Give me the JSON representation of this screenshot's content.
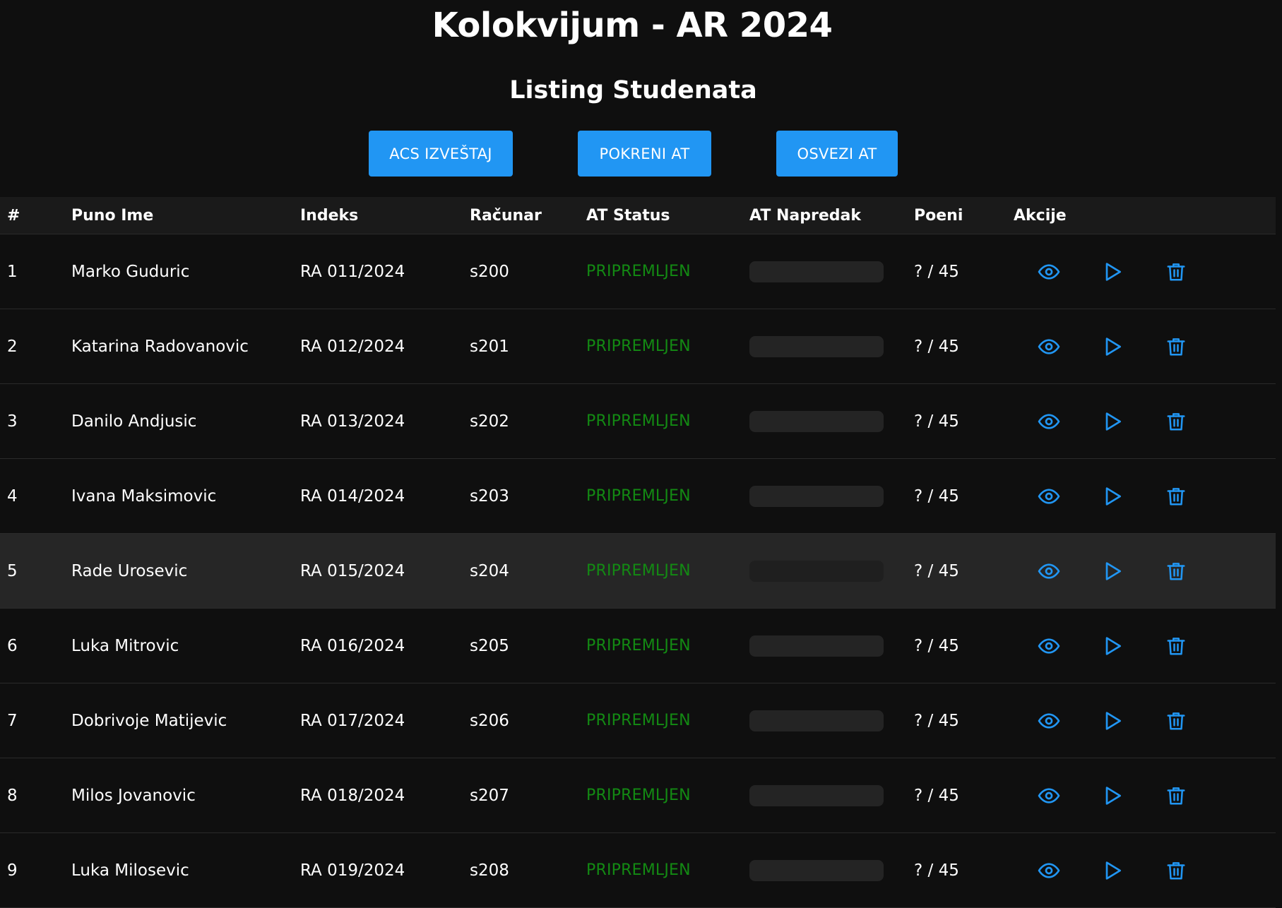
{
  "header": {
    "title": "Kolokvijum - AR 2024",
    "subtitle": "Listing Studenata"
  },
  "toolbar": {
    "acs_label": "ACS IZVEŠTAJ",
    "run_label": "POKRENI AT",
    "refresh_label": "OSVEZI AT"
  },
  "colors": {
    "accent": "#2196f3",
    "status_ok": "#138a13",
    "background": "#0f0f0f"
  },
  "table": {
    "columns": [
      "#",
      "Puno Ime",
      "Indeks",
      "Računar",
      "AT Status",
      "AT Napredak",
      "Poeni",
      "Akcije"
    ],
    "action_icons": [
      "eye-icon",
      "play-icon",
      "trash-icon"
    ],
    "rows": [
      {
        "num": "1",
        "name": "Marko Guduric",
        "index": "RA 011/2024",
        "computer": "s200",
        "status": "PRIPREMLJEN",
        "progress": 0,
        "points": "? / 45"
      },
      {
        "num": "2",
        "name": "Katarina Radovanovic",
        "index": "RA 012/2024",
        "computer": "s201",
        "status": "PRIPREMLJEN",
        "progress": 0,
        "points": "? / 45"
      },
      {
        "num": "3",
        "name": "Danilo Andjusic",
        "index": "RA 013/2024",
        "computer": "s202",
        "status": "PRIPREMLJEN",
        "progress": 0,
        "points": "? / 45"
      },
      {
        "num": "4",
        "name": "Ivana Maksimovic",
        "index": "RA 014/2024",
        "computer": "s203",
        "status": "PRIPREMLJEN",
        "progress": 0,
        "points": "? / 45"
      },
      {
        "num": "5",
        "name": "Rade Urosevic",
        "index": "RA 015/2024",
        "computer": "s204",
        "status": "PRIPREMLJEN",
        "progress": 0,
        "points": "? / 45",
        "highlighted": true
      },
      {
        "num": "6",
        "name": "Luka Mitrovic",
        "index": "RA 016/2024",
        "computer": "s205",
        "status": "PRIPREMLJEN",
        "progress": 0,
        "points": "? / 45"
      },
      {
        "num": "7",
        "name": "Dobrivoje Matijevic",
        "index": "RA 017/2024",
        "computer": "s206",
        "status": "PRIPREMLJEN",
        "progress": 0,
        "points": "? / 45"
      },
      {
        "num": "8",
        "name": "Milos Jovanovic",
        "index": "RA 018/2024",
        "computer": "s207",
        "status": "PRIPREMLJEN",
        "progress": 0,
        "points": "? / 45"
      },
      {
        "num": "9",
        "name": "Luka Milosevic",
        "index": "RA 019/2024",
        "computer": "s208",
        "status": "PRIPREMLJEN",
        "progress": 0,
        "points": "? / 45"
      }
    ]
  }
}
